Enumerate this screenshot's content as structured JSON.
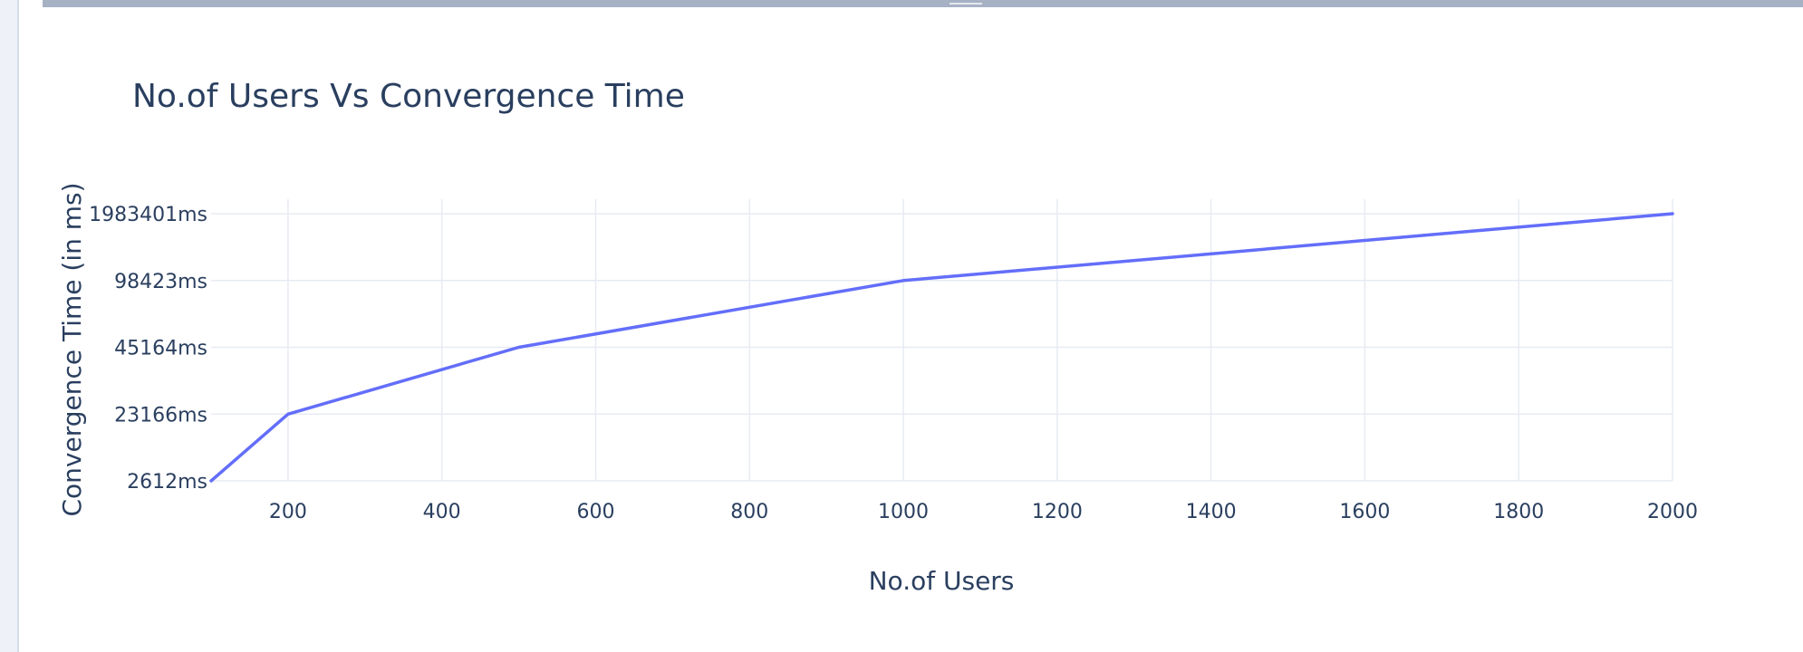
{
  "colors": {
    "line": "#636efa",
    "grid": "#e7ebf2",
    "text": "#2a3f5f",
    "top_bar": "#a7b1c4"
  },
  "chart_data": {
    "type": "line",
    "title": "No.of Users Vs Convergence Time",
    "xlabel": "No.of Users",
    "ylabel": "Convergence Time (in ms)",
    "x_ticks": [
      200,
      400,
      600,
      800,
      1000,
      1200,
      1400,
      1600,
      1800,
      2000
    ],
    "y_categories": [
      "2612ms",
      "23166ms",
      "45164ms",
      "98423ms",
      "1983401ms"
    ],
    "xlim": [
      100,
      2000
    ],
    "grid": true,
    "legend": "none",
    "series": [
      {
        "x": [
          100,
          200,
          500,
          1000,
          2000
        ],
        "y": [
          "2612ms",
          "23166ms",
          "45164ms",
          "98423ms",
          "1983401ms"
        ]
      }
    ]
  }
}
